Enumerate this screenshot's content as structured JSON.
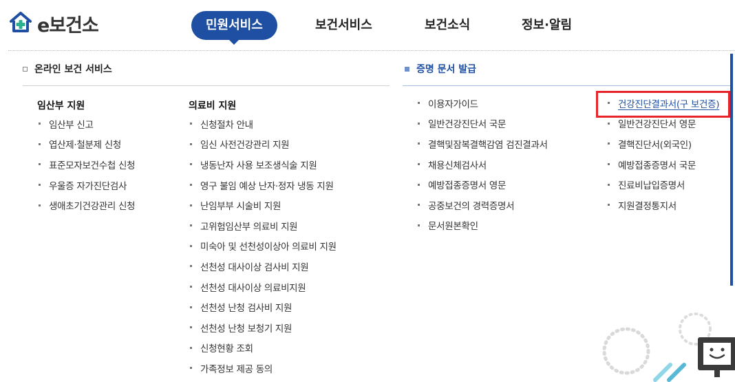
{
  "header": {
    "brand": "e보건소",
    "nav": [
      {
        "label": "민원서비스",
        "active": true
      },
      {
        "label": "보건서비스",
        "active": false
      },
      {
        "label": "보건소식",
        "active": false
      },
      {
        "label": "정보·알림",
        "active": false
      }
    ]
  },
  "online": {
    "title": "온라인 보건 서비스",
    "col1": {
      "heading": "임산부 지원",
      "items": [
        "임산부 신고",
        "엽산제·철분제 신청",
        "표준모자보건수첩 신청",
        "우울증 자가진단검사",
        "생애초기건강관리 신청"
      ]
    },
    "col2": {
      "heading": "의료비 지원",
      "items": [
        "신청절차 안내",
        "임신 사전건강관리 지원",
        "냉동난자 사용 보조생식술 지원",
        "영구 불임 예상 난자·정자 냉동 지원",
        "난임부부 시술비 지원",
        "고위험임산부 의료비 지원",
        "미숙아 및 선천성이상아 의료비 지원",
        "선천성 대사이상 검사비 지원",
        "선천성 대사이상 의료비지원",
        "선천성 난청 검사비 지원",
        "선천성 난청 보청기 지원",
        "신청현황 조회",
        "가족정보 제공 동의"
      ]
    }
  },
  "cert": {
    "title": "증명 문서 발급",
    "col1": {
      "items": [
        "이용자가이드",
        "일반건강진단서 국문",
        "결핵및잠복결핵감염 검진결과서",
        "채용신체검사서",
        "예방접종증명서 영문",
        "공중보건의 경력증명서",
        "문서원본확인"
      ]
    },
    "col2": {
      "items": [
        "건강진단결과서(구 보건증)",
        "일반건강진단서 영문",
        "결핵진단서(외국인)",
        "예방접종증명서 국문",
        "진료비납입증명서",
        "지원결정통지서"
      ]
    }
  },
  "colors": {
    "accent": "#1e4fa2",
    "highlight": "#e8242b",
    "logo_green": "#2bb18f"
  }
}
